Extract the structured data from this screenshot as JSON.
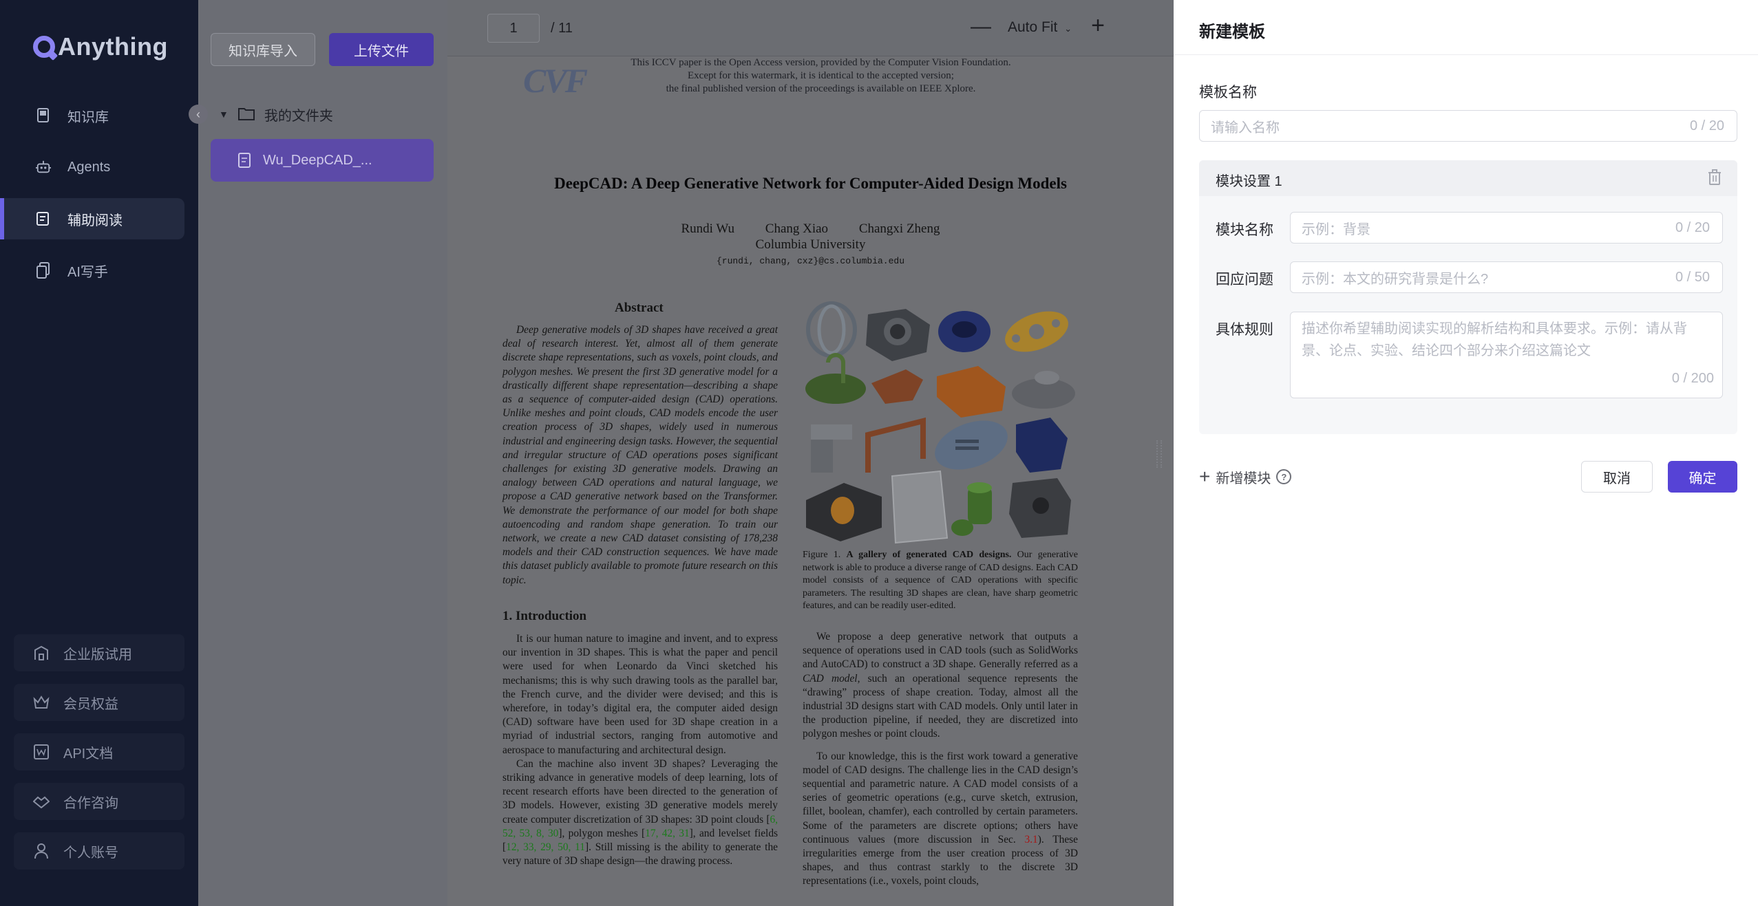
{
  "app": {
    "logo_text": "Anything"
  },
  "sidebar": {
    "items": [
      {
        "label": "知识库",
        "icon": "book-icon",
        "active": false
      },
      {
        "label": "Agents",
        "icon": "robot-icon",
        "active": false
      },
      {
        "label": "辅助阅读",
        "icon": "reader-icon",
        "active": true
      },
      {
        "label": "AI写手",
        "icon": "document-copy-icon",
        "active": false
      }
    ],
    "bottom_items": [
      {
        "label": "企业版试用",
        "icon": "building-icon"
      },
      {
        "label": "会员权益",
        "icon": "crown-icon"
      },
      {
        "label": "API文档",
        "icon": "api-doc-icon"
      },
      {
        "label": "合作咨询",
        "icon": "handshake-icon"
      },
      {
        "label": "个人账号",
        "icon": "user-icon"
      }
    ]
  },
  "filepanel": {
    "import_label": "知识库导入",
    "upload_label": "上传文件",
    "folder_label": "我的文件夹",
    "file_name": "Wu_DeepCAD_..."
  },
  "viewer": {
    "current_page": "1",
    "total_pages": "/ 11",
    "zoom_out": "—",
    "zoom_level": "Auto Fit",
    "zoom_in": "+"
  },
  "paper": {
    "cvf_logo": "CVF",
    "watermark": [
      "This ICCV paper is the Open Access version, provided by the Computer Vision Foundation.",
      "Except for this watermark, it is identical to the accepted version;",
      "the final published version of the proceedings is available on IEEE Xplore."
    ],
    "title": "DeepCAD: A Deep Generative Network for Computer-Aided Design Models",
    "authors": [
      "Rundi Wu",
      "Chang Xiao",
      "Changxi Zheng"
    ],
    "affiliation": "Columbia University",
    "emails": "{rundi, chang, cxz}@cs.columbia.edu",
    "abstract_heading": "Abstract",
    "abstract": "Deep generative models of 3D shapes have received a great deal of research interest. Yet, almost all of them generate discrete shape representations, such as voxels, point clouds, and polygon meshes. We present the first 3D generative model for a drastically different shape representation—describing a shape as a sequence of computer-aided design (CAD) operations. Unlike meshes and point clouds, CAD models encode the user creation process of 3D shapes, widely used in numerous industrial and engineering design tasks. However, the sequential and irregular structure of CAD operations poses significant challenges for existing 3D generative models. Drawing an analogy between CAD operations and natural language, we propose a CAD generative network based on the Transformer. We demonstrate the performance of our model for both shape autoencoding and random shape generation. To train our network, we create a new CAD dataset consisting of 178,238 models and their CAD construction sequences. We have made this dataset publicly available to promote future research on this topic.",
    "intro_heading": "1. Introduction",
    "intro_p1": "It is our human nature to imagine and invent, and to express our invention in 3D shapes. This is what the paper and pencil were used for when Leonardo da Vinci sketched his mechanisms; this is why such drawing tools as the parallel bar, the French curve, and the divider were devised; and this is wherefore, in today’s digital era, the computer aided design (CAD) software have been used for 3D shape creation in a myriad of industrial sectors, ranging from automotive and aerospace to manufacturing and architectural design.",
    "intro_p2_a": "Can the machine also invent 3D shapes? Leveraging the striking advance in generative models of deep learning, lots of recent research efforts have been directed to the generation of 3D models. However, existing 3D generative models merely create computer discretization of 3D shapes: 3D point clouds [",
    "intro_p2_c1": "6, 52, 53, 8, 30",
    "intro_p2_b": "], polygon meshes [",
    "intro_p2_c2": "17, 42, 31",
    "intro_p2_c": "], and levelset fields [",
    "intro_p2_c3": "12, 33, 29, 50, 11",
    "intro_p2_d": "]. Still missing is the ability to generate the very nature of 3D shape design—the drawing process.",
    "caption_prefix": "Figure 1. ",
    "caption_bold": "A gallery of generated CAD designs.",
    "caption_rest": " Our generative network is able to produce a diverse range of CAD designs. Each CAD model consists of a sequence of CAD operations with specific parameters. The resulting 3D shapes are clean, have sharp geometric features, and can be readily user-edited.",
    "right_p1_a": "We propose a deep generative network that outputs a sequence of operations used in CAD tools (such as SolidWorks and AutoCAD) to construct a 3D shape. Generally referred as a ",
    "right_p1_em": "CAD model",
    "right_p1_b": ", such an operational sequence represents the “drawing” process of shape creation. Today, almost all the industrial 3D designs start with CAD models. Only until later in the production pipeline, if needed, they are discretized into polygon meshes or point clouds.",
    "right_p2_a": "To our knowledge, this is the first work toward a generative model of CAD designs. The challenge lies in the CAD design’s sequential and parametric nature. A CAD model consists of a series of geometric operations (e.g., curve sketch, extrusion, fillet, boolean, chamfer), each controlled by certain parameters. Some of the parameters are discrete options; others have continuous values (more discussion in Sec. ",
    "right_p2_ref": "3.1",
    "right_p2_b": "). These irregularities emerge from the user creation process of 3D shapes, and thus contrast starkly to the discrete 3D representations (i.e., voxels, point clouds,"
  },
  "drawer": {
    "title": "新建模板",
    "template_name_label": "模板名称",
    "template_name_placeholder": "请输入名称",
    "template_name_count": "0 / 20",
    "module_title": "模块设置 1",
    "module_name_label": "模块名称",
    "module_name_placeholder": "示例：背景",
    "module_name_count": "0 / 20",
    "question_label": "回应问题",
    "question_placeholder": "示例：本文的研究背景是什么?",
    "question_count": "0 / 50",
    "rules_label": "具体规则",
    "rules_placeholder": "描述你希望辅助阅读实现的解析结构和具体要求。示例：请从背景、论点、实验、结论四个部分来介绍这篇论文",
    "rules_count": "0 / 200",
    "add_module_label": "新增模块",
    "help_glyph": "?",
    "cancel_label": "取消",
    "ok_label": "确定"
  },
  "colors": {
    "accent": "#5643d6",
    "sidebar_bg": "#141a2e",
    "active_indicator": "#6c63e6"
  }
}
